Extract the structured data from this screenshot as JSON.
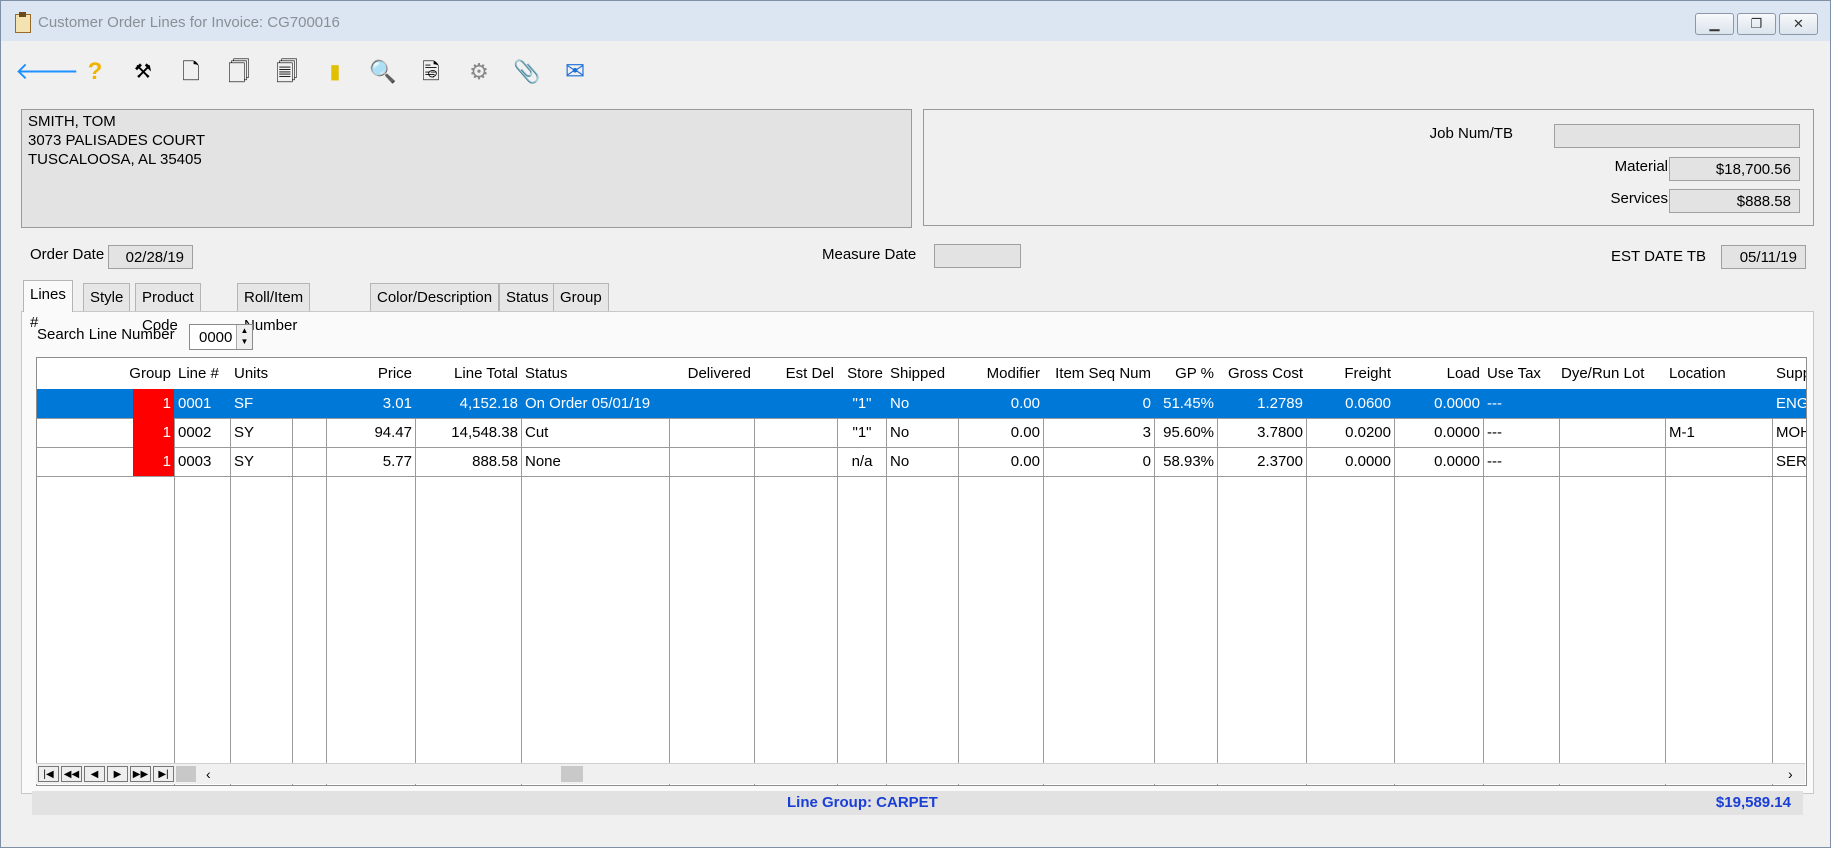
{
  "window": {
    "title": "Customer Order Lines for Invoice: CG700016"
  },
  "toolbar_icons": [
    "back-arrow-icon",
    "help-icon",
    "tools-icon",
    "document-icon-1",
    "document-icon-2",
    "document-icon-3",
    "note-icon",
    "search-icon",
    "report-icon",
    "gear-icon",
    "attachment-icon",
    "email-icon"
  ],
  "customer": {
    "name": "SMITH, TOM",
    "address1": "3073 PALISADES COURT",
    "address2": "TUSCALOOSA, AL  35405"
  },
  "summary": {
    "job_num_label": "Job Num/TB",
    "job_num_value": "",
    "material_label": "Material",
    "material_value": "$18,700.56",
    "services_label": "Services",
    "services_value": "$888.58"
  },
  "dates": {
    "order_date_label": "Order Date",
    "order_date_value": "02/28/19",
    "measure_date_label": "Measure Date",
    "measure_date_value": "",
    "est_date_label": "EST DATE TB",
    "est_date_value": "05/11/19"
  },
  "tabs": [
    "Lines #",
    "Style",
    "Product Code",
    "Roll/Item Number",
    "Color/Description",
    "Status",
    "Group"
  ],
  "search": {
    "label": "Search Line Number",
    "value": "0000"
  },
  "table": {
    "columns": [
      "Group",
      "Line #",
      "Units",
      "",
      "Price",
      "Line Total",
      "Status",
      "Delivered",
      "Est Del",
      "Store",
      "Shipped",
      "Modifier",
      "Item Seq Num",
      "GP %",
      "Gross Cost",
      "Freight",
      "Load",
      "Use Tax",
      "Dye/Run Lot",
      "Location",
      "Supp"
    ],
    "rows": [
      [
        "1",
        "0001",
        "SF",
        "",
        "3.01",
        "4,152.18",
        "On Order 05/01/19",
        "",
        "",
        "\"1\"",
        "No",
        "0.00",
        "0",
        "51.45%",
        "1.2789",
        "0.0600",
        "0.0000",
        "---",
        "",
        "",
        "ENG"
      ],
      [
        "1",
        "0002",
        "SY",
        "",
        "94.47",
        "14,548.38",
        "Cut",
        "",
        "",
        "\"1\"",
        "No",
        "0.00",
        "3",
        "95.60%",
        "3.7800",
        "0.0200",
        "0.0000",
        "---",
        "",
        "M-1",
        "MOH"
      ],
      [
        "1",
        "0003",
        "SY",
        "",
        "5.77",
        "888.58",
        "None",
        "",
        "",
        "n/a",
        "No",
        "0.00",
        "0",
        "58.93%",
        "2.3700",
        "0.0000",
        "0.0000",
        "---",
        "",
        "",
        "SERV"
      ]
    ]
  },
  "status": {
    "line_group": "Line Group: CARPET",
    "total": "$19,589.14"
  },
  "colors": {
    "selection": "#0078d7",
    "group_cell": "#ff0000",
    "status_text": "#1a3fd6"
  }
}
